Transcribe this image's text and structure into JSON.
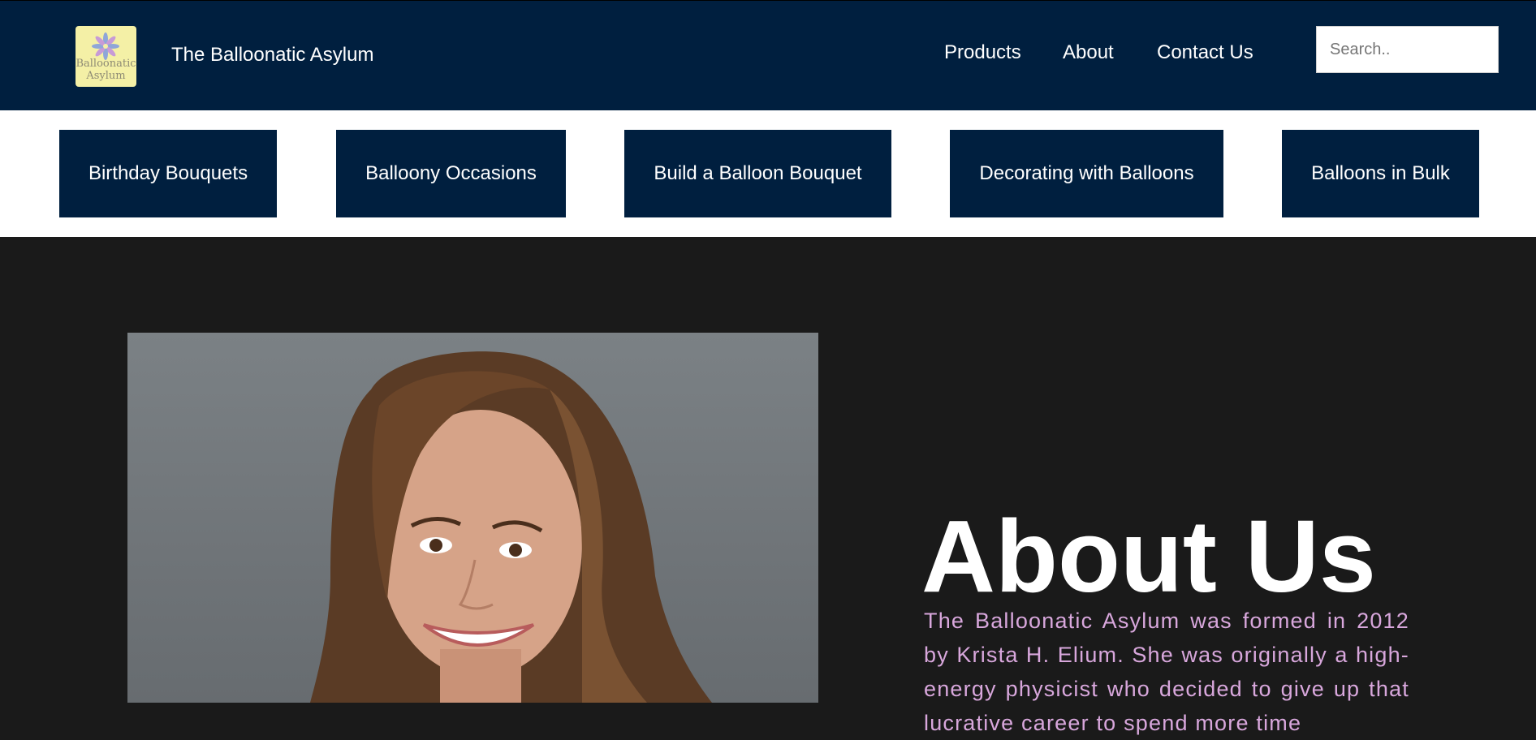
{
  "header": {
    "logo_text_line1": "Balloonatic",
    "logo_text_line2": "Asylum",
    "site_title": "The Balloonatic Asylum",
    "nav": [
      "Products",
      "About",
      "Contact Us"
    ],
    "search_placeholder": "Search.."
  },
  "categories": [
    "Birthday Bouquets",
    "Balloony Occasions",
    "Build a Balloon Bouquet",
    "Decorating with Balloons",
    "Balloons in Bulk"
  ],
  "about": {
    "title": "About Us",
    "text": "The Balloonatic Asylum was formed in 2012 by Krista H. Elium. She was originally a high-energy physicist who decided to give up that lucrative career to spend more time"
  },
  "colors": {
    "navy": "#001f3f",
    "background": "#1a1a1a",
    "about_text": "#d8a7dc",
    "logo_bg": "#f4f0a6"
  }
}
